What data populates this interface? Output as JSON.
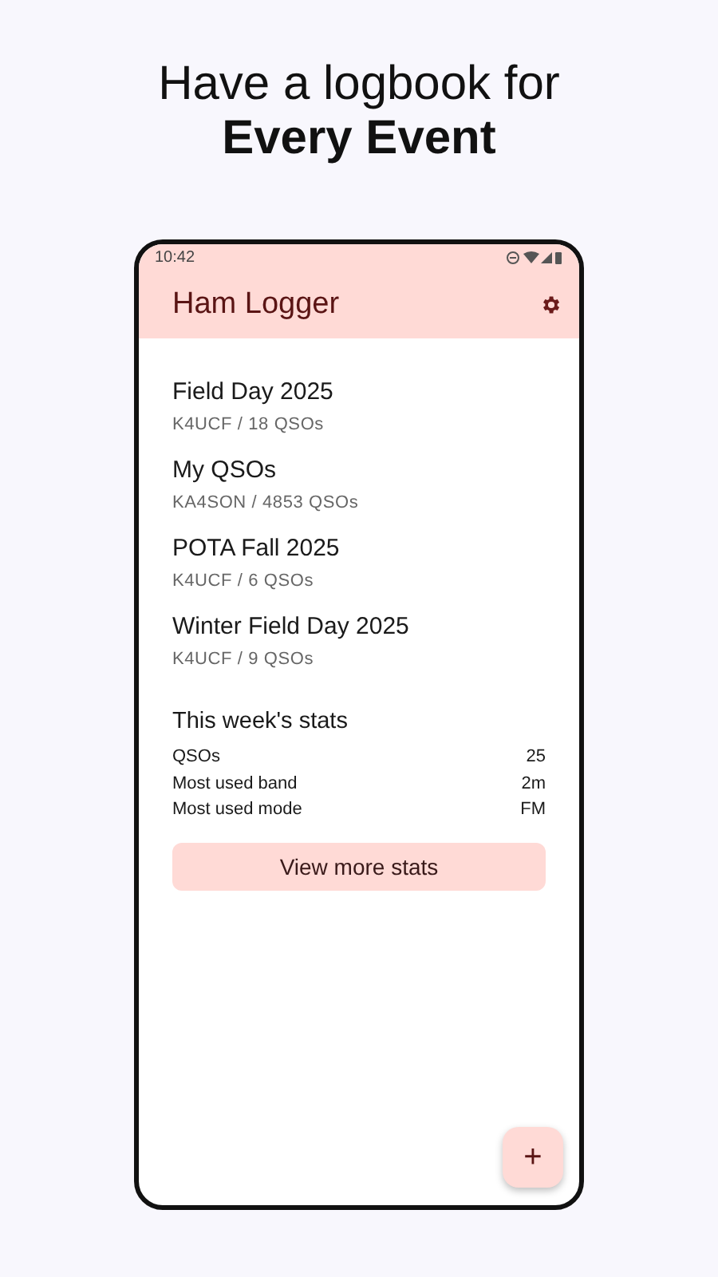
{
  "headline": {
    "line_1": "Have a logbook for",
    "line_2": "Every Event"
  },
  "status_bar": {
    "time": "10:42"
  },
  "app_bar": {
    "title": "Ham Logger"
  },
  "logbooks": [
    {
      "name": "Field Day 2025",
      "detail": "K4UCF / 18 QSOs"
    },
    {
      "name": "My QSOs",
      "detail": "KA4SON / 4853 QSOs"
    },
    {
      "name": "POTA Fall 2025",
      "detail": "K4UCF / 6 QSOs"
    },
    {
      "name": "Winter Field Day 2025",
      "detail": "K4UCF / 9 QSOs"
    }
  ],
  "stats": {
    "title": "This week's stats",
    "rows": [
      {
        "label": "QSOs",
        "value": "25"
      },
      {
        "label": "Most used band",
        "value": "2m"
      },
      {
        "label": "Most used mode",
        "value": "FM"
      }
    ],
    "button": "View more stats"
  },
  "fab": "+"
}
